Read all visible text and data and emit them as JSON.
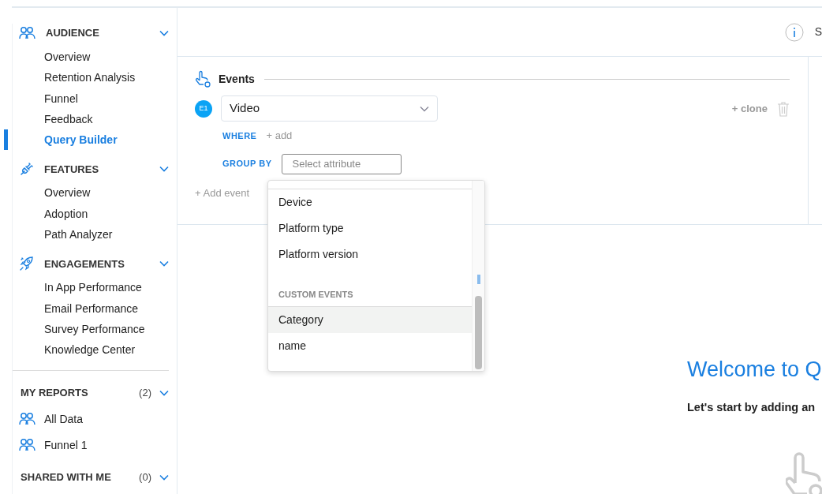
{
  "sidebar": {
    "sections": [
      {
        "title": "AUDIENCE",
        "expanded": true,
        "items": [
          {
            "label": "Overview",
            "selected": false
          },
          {
            "label": "Retention Analysis",
            "selected": false
          },
          {
            "label": "Funnel",
            "selected": false
          },
          {
            "label": "Feedback",
            "selected": false
          },
          {
            "label": "Query Builder",
            "selected": true
          }
        ]
      },
      {
        "title": "FEATURES",
        "expanded": true,
        "items": [
          {
            "label": "Overview",
            "selected": false
          },
          {
            "label": "Adoption",
            "selected": false
          },
          {
            "label": "Path Analyzer",
            "selected": false
          }
        ]
      },
      {
        "title": "ENGAGEMENTS",
        "expanded": true,
        "items": [
          {
            "label": "In App Performance",
            "selected": false
          },
          {
            "label": "Email Performance",
            "selected": false
          },
          {
            "label": "Survey Performance",
            "selected": false
          },
          {
            "label": "Knowledge Center",
            "selected": false
          }
        ]
      }
    ],
    "reports": [
      {
        "title": "MY REPORTS",
        "count": "(2)",
        "expanded": true,
        "items": [
          {
            "label": "All Data",
            "selected": false
          },
          {
            "label": "Funnel 1",
            "selected": false
          }
        ]
      },
      {
        "title": "SHARED WITH ME",
        "count": "(0)",
        "expanded": true
      }
    ]
  },
  "toolbar": {
    "label": "S"
  },
  "events": {
    "title": "Events",
    "rows": [
      {
        "badge": "E1",
        "event": "Video",
        "where_label": "WHERE",
        "where_add": "+ add",
        "group_label": "GROUP BY",
        "group_placeholder": "Select attribute",
        "clone": "+ clone"
      }
    ],
    "add_event": "+ Add event"
  },
  "dropdown": {
    "groups": [
      {
        "options": [
          {
            "label": "Device",
            "selected": false
          },
          {
            "label": "Platform type",
            "selected": false
          },
          {
            "label": "Platform version",
            "selected": false
          }
        ]
      },
      {
        "heading": "CUSTOM EVENTS",
        "options": [
          {
            "label": "Category",
            "selected": true
          },
          {
            "label": "name",
            "selected": false
          }
        ]
      }
    ]
  },
  "welcome": {
    "title": "Welcome to Q",
    "subtitle": "Let's start by adding an"
  }
}
